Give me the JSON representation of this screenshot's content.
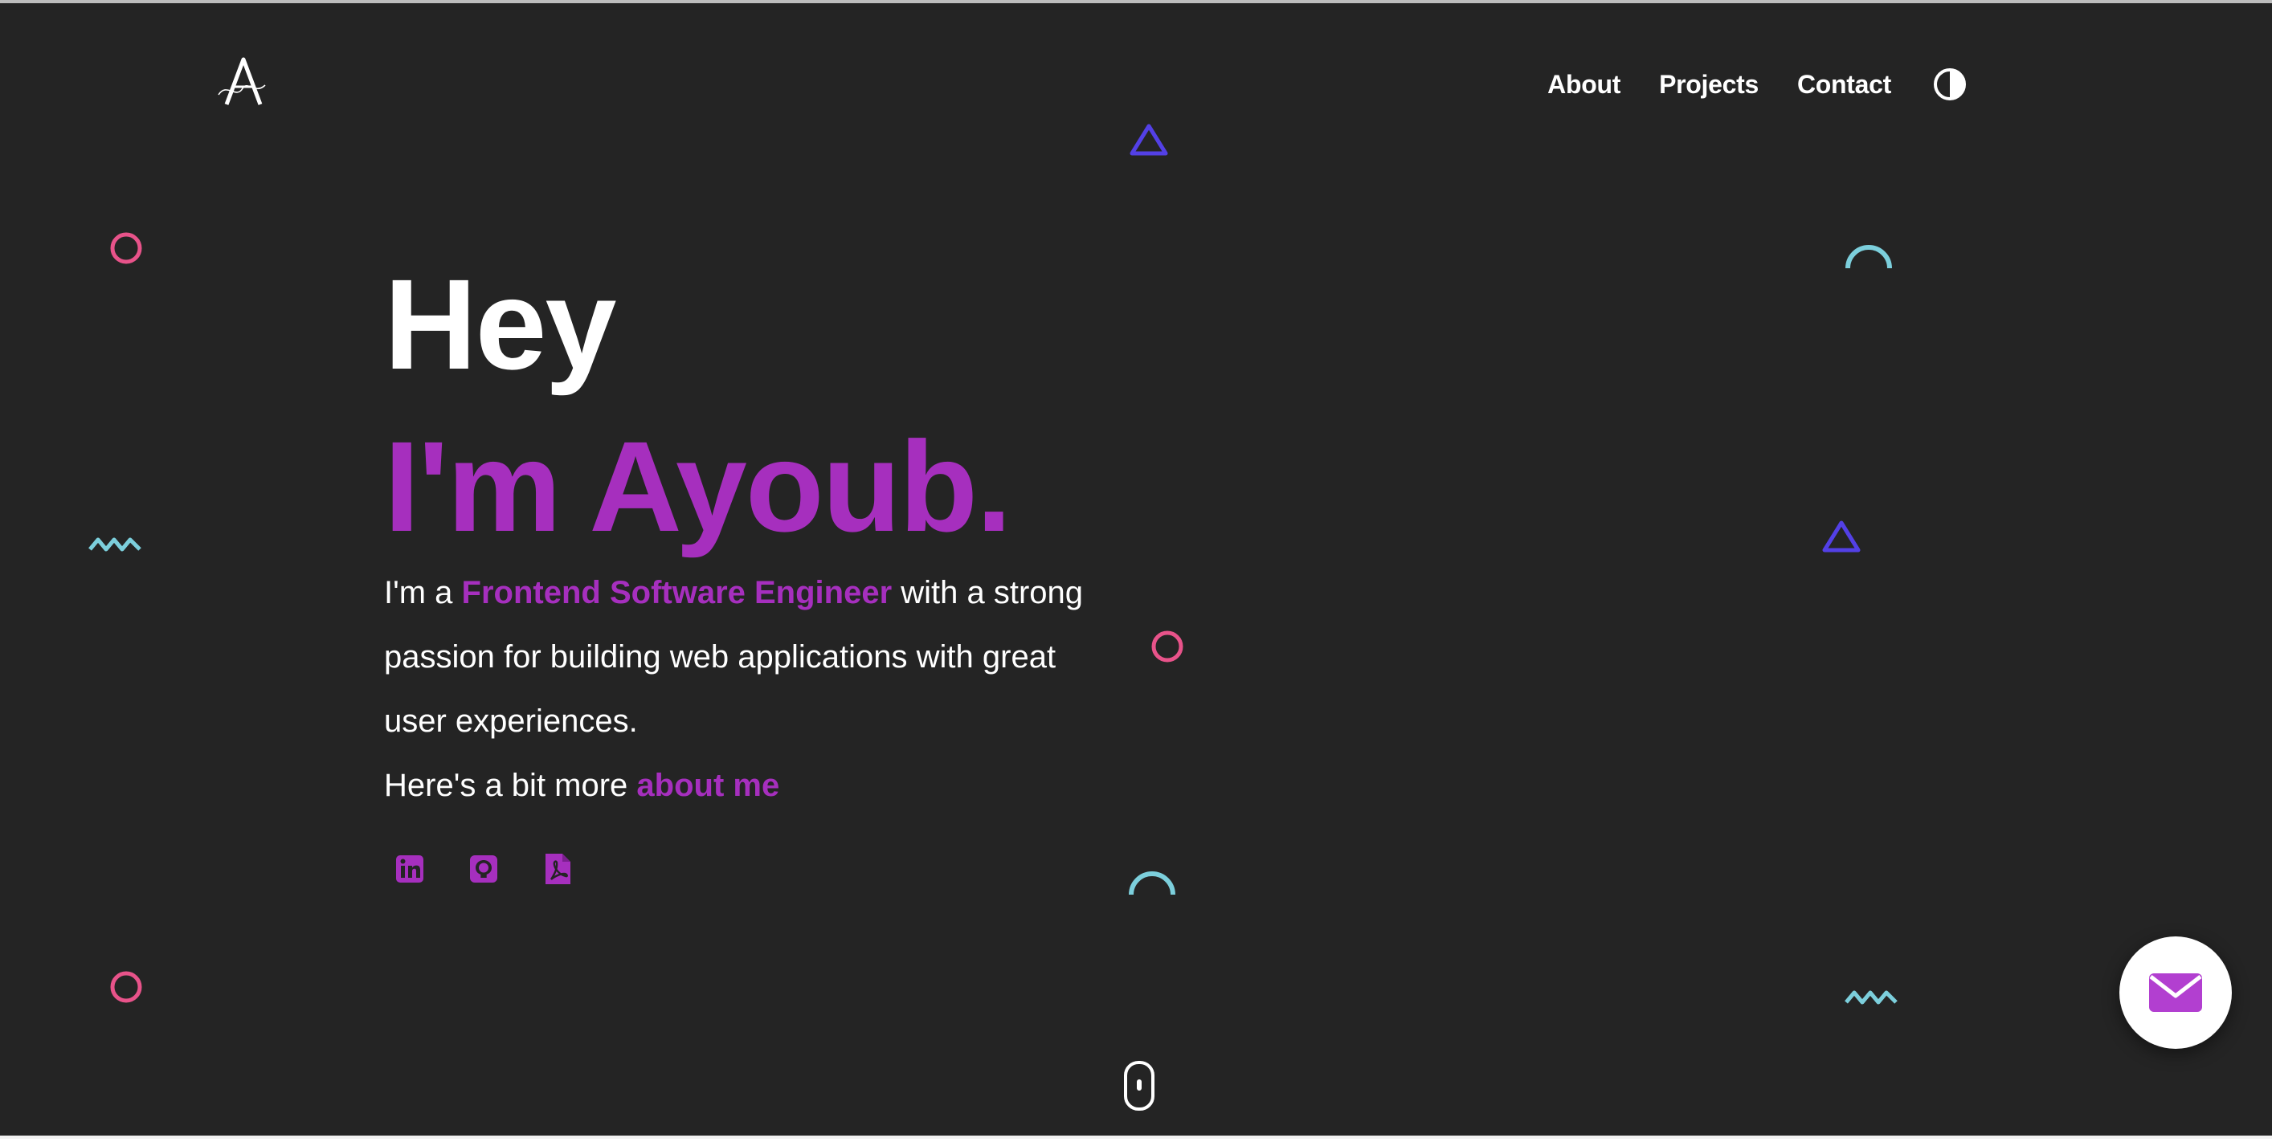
{
  "header": {
    "logo_icon": "ayoub-signature-logo",
    "nav": [
      {
        "label": "About"
      },
      {
        "label": "Projects"
      },
      {
        "label": "Contact"
      }
    ],
    "theme_toggle_icon": "half-circle-contrast-icon"
  },
  "hero": {
    "greeting": "Hey",
    "name": "I'm Ayoub.",
    "intro_prefix": "I'm a ",
    "role": "Frontend Software Engineer",
    "intro_suffix": " with a strong passion for building web applications with great user experiences.",
    "more_prefix": "Here's a bit more ",
    "more_link": "about me",
    "socials": [
      {
        "icon": "linkedin-icon"
      },
      {
        "icon": "github-icon"
      },
      {
        "icon": "pdf-resume-icon"
      }
    ]
  },
  "colors": {
    "background": "#242424",
    "accent": "#a62fbe",
    "text": "#ffffff",
    "decor_pink": "#e8538a",
    "decor_cyan": "#7ccfdc",
    "decor_blue": "#5340e6"
  },
  "floating": {
    "scroll_icon": "mouse-scroll-icon",
    "mail_icon": "envelope-icon"
  }
}
